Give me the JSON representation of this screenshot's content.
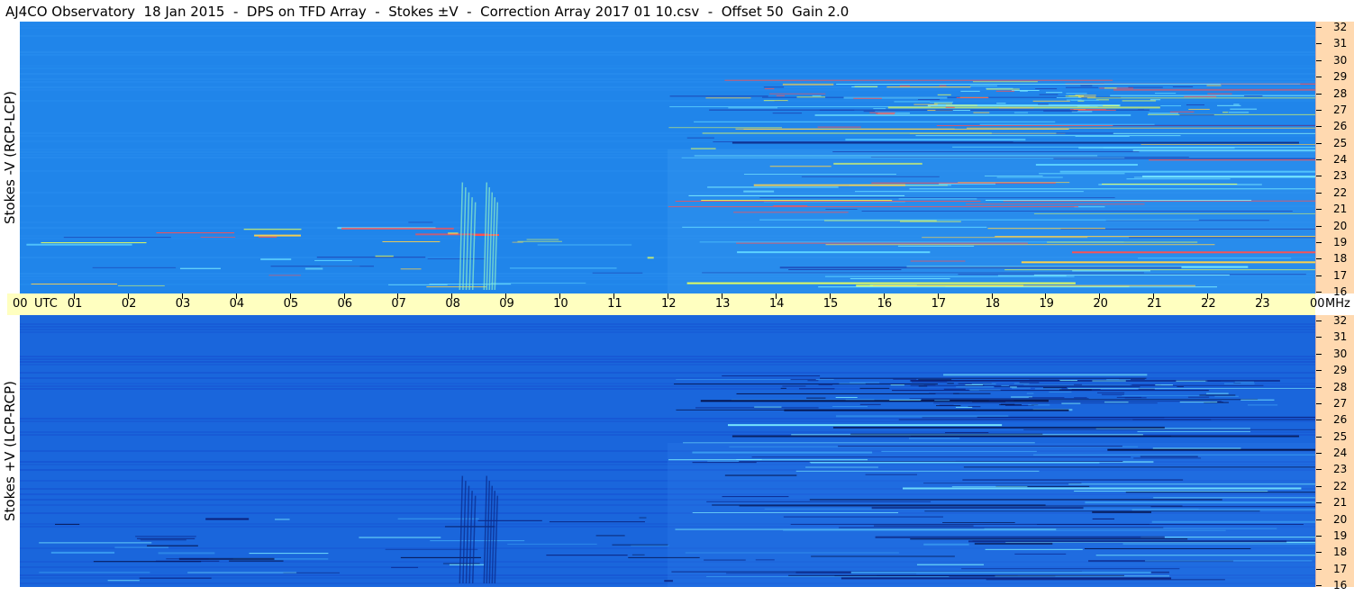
{
  "title": "AJ4CO Observatory  18 Jan 2015  -  DPS on TFD Array  -  Stokes ±V  -  Correction Array 2017 01 10.csv  -  Offset 50  Gain 2.0",
  "panels": [
    {
      "label": "Stokes -V (RCP-LCP)",
      "bg": "#2085ea",
      "polarity": "positive"
    },
    {
      "label": "Stokes +V (LCP-RCP)",
      "bg": "#1a66dc",
      "polarity": "negative"
    }
  ],
  "time_axis": {
    "start_label": "00",
    "utc_label": "UTC",
    "end_label": "00",
    "hours": [
      "01",
      "02",
      "03",
      "04",
      "05",
      "06",
      "07",
      "08",
      "09",
      "10",
      "11",
      "12",
      "13",
      "14",
      "15",
      "16",
      "17",
      "18",
      "19",
      "20",
      "21",
      "22",
      "23"
    ],
    "unit_label": "MHz"
  },
  "freq_axis": [
    "32",
    "31",
    "30",
    "29",
    "28",
    "27",
    "26",
    "25",
    "24",
    "23",
    "22",
    "21",
    "20",
    "19",
    "18",
    "17",
    "16"
  ],
  "colors": {
    "panel_top": "#2085ea",
    "panel_bottom": "#1a66dc",
    "time_axis_bg": "#ffffc0",
    "freq_axis_bg": "#ffd9b0"
  },
  "chart_data": {
    "type": "heatmap",
    "x": {
      "label": "UTC",
      "range": [
        0,
        24
      ],
      "unit": "hour"
    },
    "y": {
      "label": "MHz",
      "range": [
        16,
        32
      ],
      "unit": "MHz"
    },
    "features": [
      {
        "name": "narrowband interference",
        "hours": [
          12.0,
          24.0
        ],
        "mhz": [
          16.2,
          28.5
        ]
      },
      {
        "name": "broadband bursts",
        "hours": [
          8.1,
          8.9
        ],
        "mhz": [
          16.0,
          22.5
        ]
      },
      {
        "name": "interference band",
        "hours": [
          13.2,
          23.8
        ],
        "mhz": [
          24.8,
          25.0
        ]
      }
    ]
  }
}
